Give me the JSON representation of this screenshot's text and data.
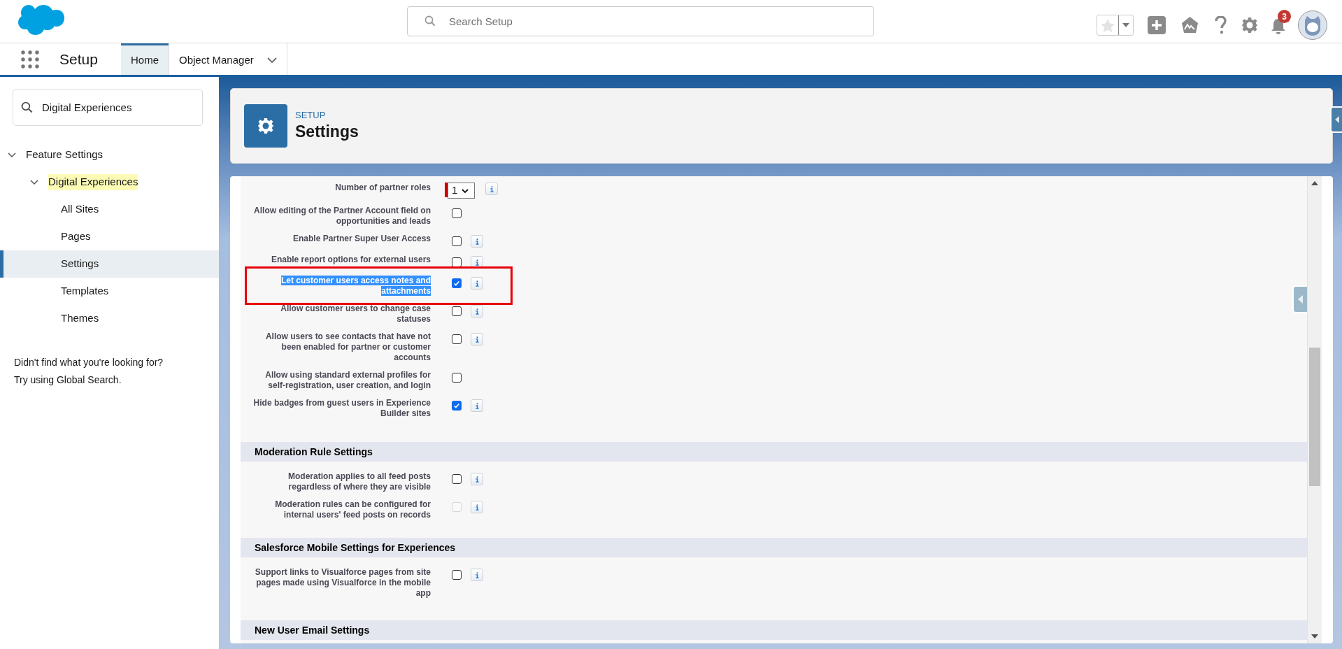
{
  "header": {
    "search": {
      "placeholder": "Search Setup"
    },
    "notification_count": "3"
  },
  "nav": {
    "app_name": "Setup",
    "tabs": [
      {
        "label": "Home",
        "selected": true,
        "has_menu": false
      },
      {
        "label": "Object Manager",
        "selected": false,
        "has_menu": true
      }
    ]
  },
  "sidebar": {
    "search": {
      "value": "Digital Experiences"
    },
    "tree": [
      {
        "label": "Feature Settings",
        "expanded": true,
        "match": false,
        "selected": false,
        "children": [
          {
            "label": "Digital Experiences",
            "expanded": true,
            "match": true,
            "selected": false,
            "children": [
              {
                "label": "All Sites",
                "match": false,
                "selected": false
              },
              {
                "label": "Pages",
                "match": false,
                "selected": false
              },
              {
                "label": "Settings",
                "match": false,
                "selected": true
              },
              {
                "label": "Templates",
                "match": false,
                "selected": false
              },
              {
                "label": "Themes",
                "match": false,
                "selected": false
              }
            ]
          }
        ]
      }
    ],
    "help": [
      "Didn't find what you're looking for?",
      "Try using Global Search."
    ]
  },
  "page_header": {
    "eyebrow": "SETUP",
    "title": "Settings"
  },
  "sections": [
    {
      "rows": [
        {
          "kind": "select",
          "label": "Number of partner roles",
          "value": "1",
          "required": true,
          "info": true
        },
        {
          "kind": "checkbox",
          "label": "Allow editing of the Partner Account field on opportunities and leads",
          "checked": false,
          "disabled": false,
          "info": false,
          "text_selected": false,
          "outlined": false
        },
        {
          "kind": "checkbox",
          "label": "Enable Partner Super User Access",
          "checked": false,
          "disabled": false,
          "info": true,
          "text_selected": false,
          "outlined": false
        },
        {
          "kind": "checkbox",
          "label": "Enable report options for external users",
          "checked": false,
          "disabled": false,
          "info": true,
          "text_selected": false,
          "outlined": false
        },
        {
          "kind": "checkbox",
          "label": "Let customer users access notes and attachments",
          "checked": true,
          "disabled": false,
          "info": true,
          "text_selected": true,
          "outlined": true
        },
        {
          "kind": "checkbox",
          "label": "Allow customer users to change case statuses",
          "checked": false,
          "disabled": false,
          "info": true,
          "text_selected": false,
          "outlined": false
        },
        {
          "kind": "checkbox",
          "label": "Allow users to see contacts that have not been enabled for partner or customer accounts",
          "checked": false,
          "disabled": false,
          "info": true,
          "text_selected": false,
          "outlined": false
        },
        {
          "kind": "checkbox",
          "label": "Allow using standard external profiles for self-registration, user creation, and login",
          "checked": false,
          "disabled": false,
          "info": false,
          "text_selected": false,
          "outlined": false
        },
        {
          "kind": "checkbox",
          "label": "Hide badges from guest users in Experience Builder sites",
          "checked": true,
          "disabled": false,
          "info": true,
          "text_selected": false,
          "outlined": false
        }
      ]
    },
    {
      "title": "Moderation Rule Settings",
      "rows": [
        {
          "kind": "checkbox",
          "label": "Moderation applies to all feed posts regardless of where they are visible",
          "checked": false,
          "disabled": false,
          "info": true,
          "text_selected": false,
          "outlined": false
        },
        {
          "kind": "checkbox",
          "label": "Moderation rules can be configured for internal users' feed posts on records",
          "checked": false,
          "disabled": true,
          "info": true,
          "text_selected": false,
          "outlined": false
        }
      ]
    },
    {
      "title": "Salesforce Mobile Settings for Experiences",
      "rows": [
        {
          "kind": "checkbox",
          "label": "Support links to Visualforce pages from site pages made using Visualforce in the mobile app",
          "checked": false,
          "disabled": false,
          "info": true,
          "text_selected": false,
          "outlined": false
        }
      ]
    },
    {
      "title": "New User Email Settings"
    }
  ]
}
